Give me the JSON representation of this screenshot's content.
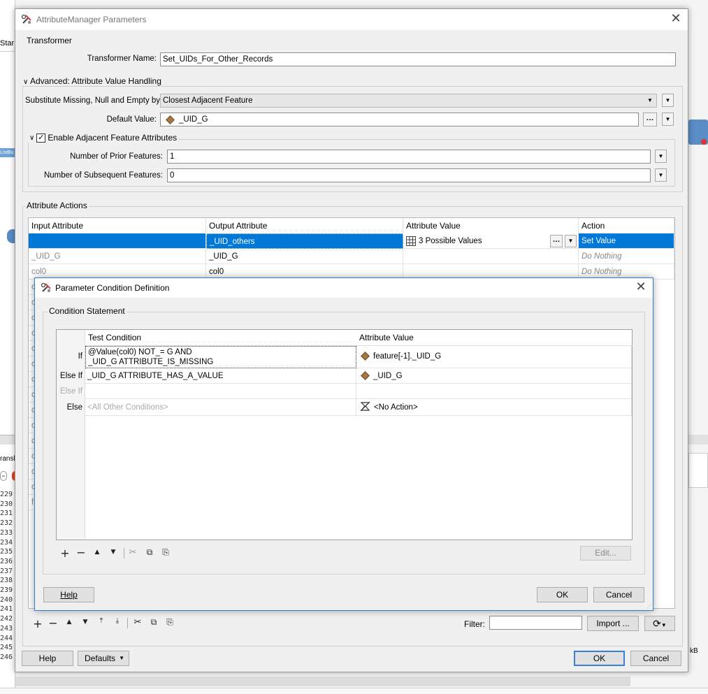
{
  "window": {
    "title": "AttributeManager Parameters"
  },
  "background": {
    "tab_fragment": "Star",
    "node_label": "ListBu",
    "panel_fragment": "ransl",
    "size_fragment": "kB",
    "line_numbers": [
      "229",
      "230",
      "231",
      "232",
      "233",
      "234",
      "235",
      "236",
      "237",
      "238",
      "239",
      "240",
      "241",
      "242",
      "243",
      "244",
      "245",
      "246"
    ]
  },
  "transformer": {
    "group_label": "Transformer",
    "name_label": "Transformer Name:",
    "name_value": "Set_UIDs_For_Other_Records"
  },
  "advanced": {
    "group_label": "Advanced: Attribute Value Handling",
    "substitute_label": "Substitute Missing, Null and Empty by:",
    "substitute_value": "Closest Adjacent Feature",
    "default_label": "Default Value:",
    "default_value": "_UID_G",
    "adjacent_checkbox_label": "Enable Adjacent Feature Attributes",
    "adjacent_checked": true,
    "prior_label": "Number of Prior Features:",
    "prior_value": "1",
    "subsequent_label": "Number of Subsequent Features:",
    "subsequent_value": "0"
  },
  "actions": {
    "group_label": "Attribute Actions",
    "columns": [
      "Input Attribute",
      "Output Attribute",
      "Attribute Value",
      "Action"
    ],
    "rows": [
      {
        "input": "",
        "output": "_UID_others",
        "value": "3 Possible Values",
        "action": "Set Value",
        "selected": true
      },
      {
        "input": "_UID_G",
        "output": "_UID_G",
        "value": "",
        "action": "Do Nothing",
        "selected": false
      },
      {
        "input": "col0",
        "output": "col0",
        "value": "",
        "action": "Do Nothing",
        "selected": false
      }
    ],
    "hidden_row_letters": [
      "c",
      "c",
      "c",
      "c",
      "c",
      "c",
      "c",
      "c",
      "c",
      "c",
      "c",
      "c",
      "c",
      "c",
      "f"
    ],
    "filter_label": "Filter:",
    "filter_value": "",
    "import_label": "Import ...",
    "refresh_icon": "refresh-icon"
  },
  "footer": {
    "help_label": "Help",
    "defaults_label": "Defaults",
    "ok_label": "OK",
    "cancel_label": "Cancel"
  },
  "condition_dialog": {
    "title": "Parameter Condition Definition",
    "group_label": "Condition Statement",
    "columns": [
      "Test Condition",
      "Attribute Value"
    ],
    "rows": [
      {
        "label": "If",
        "condition_line1": "@Value(col0) NOT_= G AND",
        "condition_line2": "_UID_G ATTRIBUTE_IS_MISSING",
        "value": "feature[-1]._UID_G",
        "value_icon": "attribute-icon"
      },
      {
        "label": "Else If",
        "condition_line1": "_UID_G ATTRIBUTE_HAS_A_VALUE",
        "condition_line2": "",
        "value": "_UID_G",
        "value_icon": "attribute-icon"
      },
      {
        "label": "Else If",
        "condition_line1": "",
        "condition_line2": "",
        "value": "",
        "value_icon": ""
      },
      {
        "label": "Else",
        "condition_line1": "<All Other Conditions>",
        "condition_line2": "",
        "value": "<No Action>",
        "value_icon": "no-action-icon"
      }
    ],
    "edit_label": "Edit...",
    "help_label": "Help",
    "ok_label": "OK",
    "cancel_label": "Cancel"
  }
}
